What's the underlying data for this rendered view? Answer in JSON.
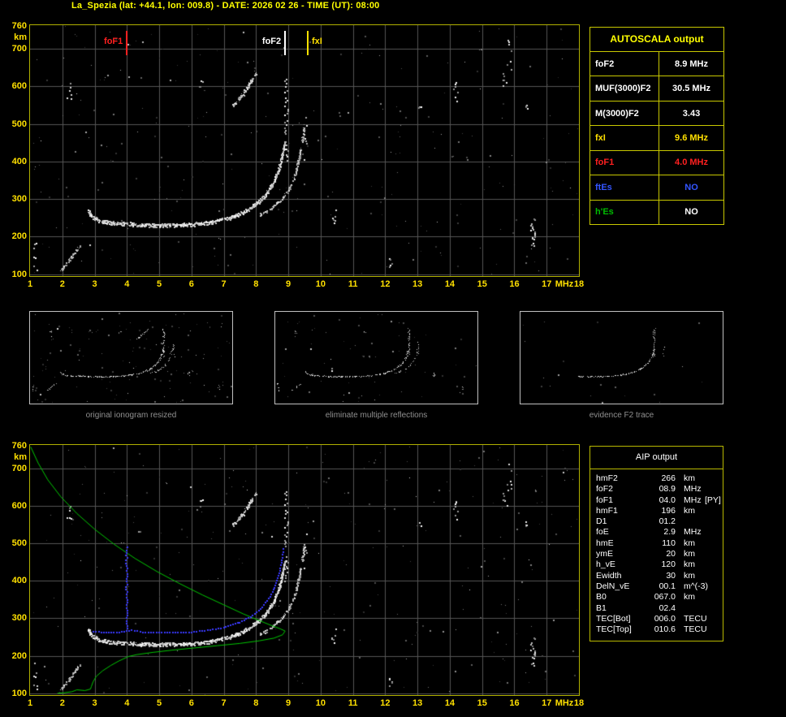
{
  "header": {
    "title": "La_Spezia (lat: +44.1, lon: 009.8) - DATE: 2026 02 26 - TIME (UT): 08:00"
  },
  "colors": {
    "background": "#000000",
    "title_yellow": "#ffff00",
    "axis_yellow": "#ffe000",
    "plot_border_yellow": "#b0b000",
    "table_border_yellow": "#c8c800",
    "grid_gray": "#565656",
    "trace_white": "#ffffff",
    "marker_red": "#ff2020",
    "status_blue": "#3355ff",
    "status_green": "#00bb00",
    "profile_green": "#00c800",
    "restored_blue": "#3a3aff",
    "caption_gray": "#909090",
    "thumb_border": "#c0c0c0"
  },
  "autoscala": {
    "title": "AUTOSCALA output",
    "rows": [
      {
        "param": "foF2",
        "value": "8.9 MHz",
        "param_color": "#ffffff",
        "value_color": "#ffffff"
      },
      {
        "param": "MUF(3000)F2",
        "value": "30.5 MHz",
        "param_color": "#ffffff",
        "value_color": "#ffffff"
      },
      {
        "param": "M(3000)F2",
        "value": "3.43",
        "param_color": "#ffffff",
        "value_color": "#ffffff"
      },
      {
        "param": "fxI",
        "value": "9.6 MHz",
        "param_color": "#ffe000",
        "value_color": "#ffe000"
      },
      {
        "param": "foF1",
        "value": "4.0 MHz",
        "param_color": "#ff2020",
        "value_color": "#ff2020"
      },
      {
        "param": "ftEs",
        "value": "NO",
        "param_color": "#3355ff",
        "value_color": "#3355ff"
      },
      {
        "param": "h'Es",
        "value": "NO",
        "param_color": "#00bb00",
        "value_color": "#ffffff"
      }
    ]
  },
  "thumbnails": [
    {
      "caption": "original ionogram resized"
    },
    {
      "caption": "eliminate multiple reflections"
    },
    {
      "caption": "evidence F2 trace"
    }
  ],
  "aip": {
    "title": "AIP output",
    "rows": [
      {
        "param": "hmF2",
        "value": "266",
        "unit": "km",
        "note": ""
      },
      {
        "param": "foF2",
        "value": "08.9",
        "unit": "MHz",
        "note": ""
      },
      {
        "param": "foF1",
        "value": "04.0",
        "unit": "MHz",
        "note": "[PY]"
      },
      {
        "param": "hmF1",
        "value": "196",
        "unit": "km",
        "note": ""
      },
      {
        "param": "D1",
        "value": "01.2",
        "unit": "",
        "note": ""
      },
      {
        "param": "foE",
        "value": "2.9",
        "unit": "MHz",
        "note": ""
      },
      {
        "param": "hmE",
        "value": "110",
        "unit": "km",
        "note": ""
      },
      {
        "param": "ymE",
        "value": "20",
        "unit": "km",
        "note": ""
      },
      {
        "param": "h_vE",
        "value": "120",
        "unit": "km",
        "note": ""
      },
      {
        "param": "Ewidth",
        "value": "30",
        "unit": "km",
        "note": ""
      },
      {
        "param": "DelN_vE",
        "value": "00.1",
        "unit": "m^(-3)",
        "note": ""
      },
      {
        "param": "B0",
        "value": "067.0",
        "unit": "km",
        "note": ""
      },
      {
        "param": "B1",
        "value": "02.4",
        "unit": "",
        "note": ""
      },
      {
        "param": "TEC[Bot]",
        "value": "006.0",
        "unit": "TECU",
        "note": ""
      },
      {
        "param": "TEC[Top]",
        "value": "010.6",
        "unit": "TECU",
        "note": ""
      }
    ]
  },
  "chart_data": {
    "type": "scatter",
    "title": "ionogram - La_Spezia 2026-02-26 08:00 UT",
    "xlabel": "MHz",
    "ylabel": "km",
    "xlim": [
      1,
      18
    ],
    "ylim": [
      100,
      760
    ],
    "x_ticks": [
      1,
      2,
      3,
      4,
      5,
      6,
      7,
      8,
      9,
      10,
      11,
      12,
      13,
      14,
      15,
      16,
      17,
      18
    ],
    "y_ticks": [
      760,
      700,
      600,
      500,
      400,
      300,
      200,
      100
    ],
    "grid": true,
    "markers": [
      {
        "name": "foF1",
        "freq_mhz": 4.0,
        "color": "#ff2020"
      },
      {
        "name": "foF2",
        "freq_mhz": 8.9,
        "color": "#ffffff"
      },
      {
        "name": "fxI",
        "freq_mhz": 9.6,
        "color": "#ffe000"
      }
    ],
    "traces": {
      "f_ordinary": [
        [
          2.78,
          272
        ],
        [
          2.92,
          254
        ],
        [
          3.1,
          244
        ],
        [
          3.35,
          239
        ],
        [
          3.7,
          236
        ],
        [
          4.0,
          235
        ],
        [
          4.35,
          233
        ],
        [
          4.75,
          231
        ],
        [
          5.15,
          231
        ],
        [
          5.55,
          232
        ],
        [
          5.95,
          233
        ],
        [
          6.35,
          236
        ],
        [
          6.7,
          241
        ],
        [
          7.0,
          247
        ],
        [
          7.3,
          255
        ],
        [
          7.6,
          266
        ],
        [
          7.85,
          279
        ],
        [
          8.1,
          296
        ],
        [
          8.3,
          315
        ],
        [
          8.5,
          340
        ],
        [
          8.65,
          368
        ],
        [
          8.75,
          398
        ],
        [
          8.82,
          425
        ],
        [
          8.88,
          455
        ]
      ],
      "f_extraordinary": [
        [
          8.1,
          258
        ],
        [
          8.45,
          276
        ],
        [
          8.75,
          298
        ],
        [
          9.0,
          326
        ],
        [
          9.18,
          362
        ],
        [
          9.32,
          408
        ],
        [
          9.42,
          455
        ],
        [
          9.48,
          500
        ]
      ],
      "e_region": [
        [
          1.95,
          112
        ],
        [
          2.15,
          132
        ],
        [
          2.35,
          155
        ],
        [
          2.55,
          178
        ]
      ],
      "second_reflection": [
        [
          7.25,
          548
        ],
        [
          7.45,
          566
        ],
        [
          7.65,
          590
        ],
        [
          7.85,
          616
        ],
        [
          7.98,
          636
        ]
      ],
      "fof2_asymptote": {
        "f": 8.92,
        "h_from": 400,
        "h_to": 640,
        "step": 5,
        "p": 0.6
      },
      "fxi_asymptote": {
        "f": 9.5,
        "h_from": 400,
        "h_to": 530,
        "step": 7,
        "p": 0.3
      },
      "noise_clusters": [
        {
          "f": 16.55,
          "h_from": 165,
          "h_to": 255,
          "n": 18
        },
        {
          "f": 16.35,
          "h_from": 540,
          "h_to": 570,
          "n": 4
        },
        {
          "f": 14.15,
          "h_from": 560,
          "h_to": 615,
          "n": 8
        },
        {
          "f": 15.7,
          "h_from": 600,
          "h_to": 665,
          "n": 8
        },
        {
          "f": 15.85,
          "h_from": 640,
          "h_to": 735,
          "n": 6
        },
        {
          "f": 13.1,
          "h_from": 540,
          "h_to": 560,
          "n": 3
        },
        {
          "f": 10.4,
          "h_from": 235,
          "h_to": 275,
          "n": 6
        },
        {
          "f": 12.15,
          "h_from": 120,
          "h_to": 165,
          "n": 5
        },
        {
          "f": 2.2,
          "h_from": 560,
          "h_to": 640,
          "n": 6
        },
        {
          "f": 1.15,
          "h_from": 100,
          "h_to": 190,
          "n": 7
        },
        {
          "f": 6.3,
          "h_from": 595,
          "h_to": 620,
          "n": 4
        }
      ]
    },
    "profile_model": {
      "green_profile": [
        [
          1.02,
          758
        ],
        [
          1.25,
          715
        ],
        [
          1.55,
          670
        ],
        [
          1.95,
          625
        ],
        [
          2.45,
          580
        ],
        [
          3.0,
          538
        ],
        [
          3.6,
          498
        ],
        [
          4.25,
          460
        ],
        [
          4.95,
          424
        ],
        [
          5.65,
          392
        ],
        [
          6.35,
          362
        ],
        [
          7.0,
          336
        ],
        [
          7.6,
          312
        ],
        [
          8.1,
          294
        ],
        [
          8.5,
          280
        ],
        [
          8.75,
          272
        ],
        [
          8.9,
          266
        ],
        [
          8.82,
          256
        ],
        [
          8.55,
          247
        ],
        [
          8.1,
          240
        ],
        [
          7.5,
          233
        ],
        [
          6.8,
          227
        ],
        [
          6.1,
          221
        ],
        [
          5.4,
          215
        ],
        [
          4.8,
          209
        ],
        [
          4.3,
          203
        ],
        [
          4.05,
          198
        ],
        [
          4.0,
          196
        ],
        [
          3.75,
          186
        ],
        [
          3.5,
          174
        ],
        [
          3.25,
          160
        ],
        [
          3.05,
          145
        ],
        [
          2.95,
          130
        ],
        [
          2.9,
          118
        ],
        [
          2.87,
          111
        ],
        [
          2.7,
          107
        ],
        [
          2.45,
          109
        ],
        [
          2.3,
          104
        ],
        [
          2.05,
          101
        ],
        [
          1.85,
          100
        ]
      ],
      "blue_restored_trace": [
        [
          2.95,
          265
        ],
        [
          3.3,
          262
        ],
        [
          3.6,
          261
        ],
        [
          3.85,
          264
        ],
        [
          4.15,
          268
        ],
        [
          4.5,
          263
        ],
        [
          5.0,
          261
        ],
        [
          5.5,
          261
        ],
        [
          6.0,
          263
        ],
        [
          6.5,
          268
        ],
        [
          7.0,
          275
        ],
        [
          7.5,
          289
        ],
        [
          7.9,
          307
        ],
        [
          8.2,
          330
        ],
        [
          8.45,
          358
        ],
        [
          8.6,
          388
        ],
        [
          8.72,
          420
        ],
        [
          8.8,
          455
        ],
        [
          8.85,
          485
        ]
      ],
      "blue_fof1_spike": {
        "f": 4.0,
        "h_from": 272,
        "h_to": 492
      }
    }
  }
}
